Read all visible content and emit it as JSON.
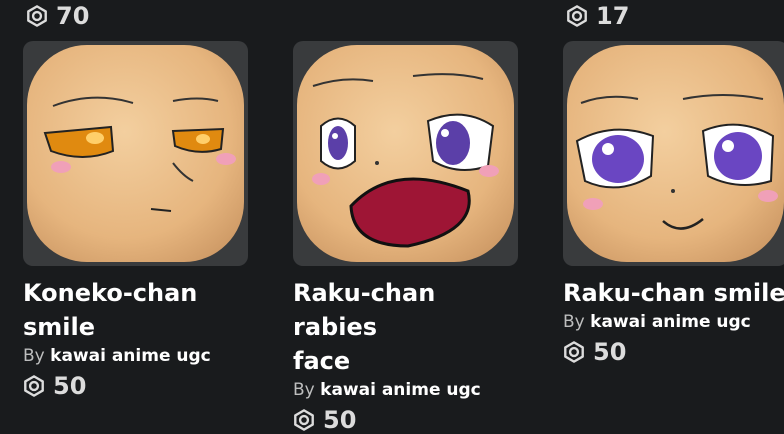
{
  "top_prices": [
    {
      "icon": "robux-icon",
      "amount": "70"
    },
    {
      "icon": "robux-icon",
      "amount": "17"
    }
  ],
  "items": [
    {
      "name": "Koneko-chan\nsmile",
      "title_line1": "Koneko-chan",
      "title_line2": "smile",
      "by_label": "By",
      "creator": "kawai anime ugc",
      "price": "50",
      "eye_color": "#e08a10"
    },
    {
      "title_line1": "Raku-chan rabies",
      "title_line2": "face",
      "by_label": "By",
      "creator": "kawai anime ugc",
      "price": "50",
      "eye_color": "#5b3fa8",
      "mouth_color": "#9e1535"
    },
    {
      "title_line1": "Raku-chan smile",
      "by_label": "By",
      "creator": "kawai anime ugc",
      "price": "50",
      "eye_color": "#6a46c2"
    }
  ],
  "colors": {
    "background": "#191b1d",
    "card_thumb_bg": "#393b3d",
    "skin": "#e8bb88",
    "blush": "#f0a0b8"
  }
}
